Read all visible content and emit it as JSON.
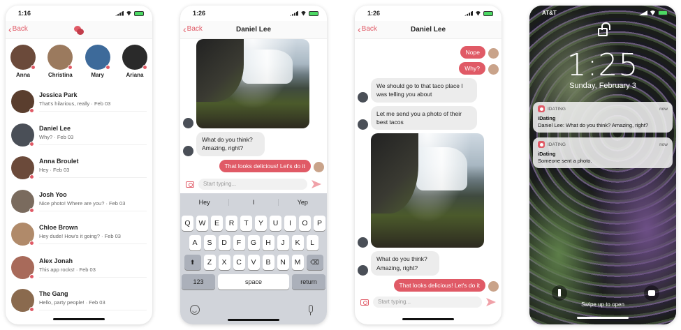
{
  "list_screen": {
    "status_time": "1:16",
    "back_label": "Back",
    "stories": [
      {
        "name": "Anna",
        "color": "#6b4a3a"
      },
      {
        "name": "Christina",
        "color": "#9b7a5e"
      },
      {
        "name": "Mary",
        "color": "#3d6a9a"
      },
      {
        "name": "Ariana",
        "color": "#2a2a2a"
      }
    ],
    "conversations": [
      {
        "name": "Jessica Park",
        "preview": "That's hilarious, really · Feb 03",
        "color": "#5a3e2e"
      },
      {
        "name": "Daniel Lee",
        "preview": "Why? · Feb 03",
        "color": "#4a4f57"
      },
      {
        "name": "Anna Broulet",
        "preview": "Hey · Feb 03",
        "color": "#6b4a3a"
      },
      {
        "name": "Josh Yoo",
        "preview": "Nice photo! Where are you? · Feb 03",
        "color": "#7a6b5e"
      },
      {
        "name": "Chloe Brown",
        "preview": "Hey dude! How's it going? · Feb 03",
        "color": "#b08a6a"
      },
      {
        "name": "Alex Jonah",
        "preview": "This app rocks! · Feb 03",
        "color": "#a86a5a"
      },
      {
        "name": "The Gang",
        "preview": "Hello, party people! · Feb 03",
        "color": "#8a6a4e"
      }
    ]
  },
  "chat_screen_keyboard": {
    "status_time": "1:26",
    "back_label": "Back",
    "title": "Daniel Lee",
    "messages": {
      "in_1": "What do you think? Amazing, right?",
      "out_1": "That looks delicious! Let's do it"
    },
    "composer_placeholder": "Start typing...",
    "suggestions": [
      "Hey",
      "I",
      "Yep"
    ],
    "keys_row1": [
      "Q",
      "W",
      "E",
      "R",
      "T",
      "Y",
      "U",
      "I",
      "O",
      "P"
    ],
    "keys_row2": [
      "A",
      "S",
      "D",
      "F",
      "G",
      "H",
      "J",
      "K",
      "L"
    ],
    "keys_row3": [
      "Z",
      "X",
      "C",
      "V",
      "B",
      "N",
      "M"
    ],
    "key_123": "123",
    "key_space": "space",
    "key_return": "return"
  },
  "chat_screen": {
    "status_time": "1:26",
    "back_label": "Back",
    "title": "Daniel Lee",
    "messages": {
      "out_nope": "Nope",
      "out_why": "Why?",
      "in_taco": "We should go to that taco place I was telling you about",
      "in_photo": "Let me send you a photo of their best tacos",
      "in_think": "What do you think? Amazing, right?",
      "out_delicious": "That looks delicious! Let's do it"
    },
    "composer_placeholder": "Start typing..."
  },
  "lock_screen": {
    "carrier": "AT&T",
    "time": "1:25",
    "date": "Sunday, February 3",
    "notifications": [
      {
        "app": "IDATING",
        "time": "now",
        "title": "iDating",
        "body": "Daniel Lee: What do you think? Amazing, right?"
      },
      {
        "app": "IDATING",
        "time": "now",
        "title": "iDating",
        "body": "Someone sent a photo."
      }
    ],
    "swipe_text": "Swipe up to open"
  },
  "colors": {
    "accent": "#e05a66",
    "incoming_bubble": "#ececec",
    "keyboard": "#d1d4da"
  }
}
